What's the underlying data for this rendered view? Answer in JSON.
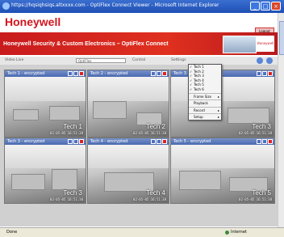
{
  "window": {
    "title": "https://hqsiqhsiqs.altxxxx.com - OptiFlex Connect Viewer - Microsoft Internet Explorer"
  },
  "header": {
    "logo": "Honeywell",
    "top_link": "Logout",
    "banner_title": "Honeywell Security & Custom Electronics – OptiFlex Connect",
    "brand": "Honeywell"
  },
  "toolbar": {
    "label_left": "Video Live",
    "select_value": "OptiFlex",
    "label_mid": "Control",
    "label_right": "Settings"
  },
  "tiles": [
    {
      "title": "Tech 1 - encrypted",
      "name": "Tech 1",
      "ts": "02-05-05 16:51:38"
    },
    {
      "title": "Tech 2 - encrypted",
      "name": "Tech 2",
      "ts": "02-05-05 16:51:38"
    },
    {
      "title": "Tech 3 - encrypted",
      "name": "Tech 3",
      "ts": "02-05-05 16:51:38"
    },
    {
      "title": "Tech 3 - encrypted",
      "name": "Tech 3",
      "ts": "02-05-05 16:51:38"
    },
    {
      "title": "Tech 4 - encrypted",
      "name": "Tech 4",
      "ts": "02-05-05 16:51:38"
    },
    {
      "title": "Tech 5 - encrypted",
      "name": "Tech 5",
      "ts": "02-05-05 16:51:38"
    }
  ],
  "context_menu": {
    "cameras": [
      "Tech 1",
      "Tech 2",
      "Tech 3",
      "Tech 4",
      "Tech 5",
      "Tech 6"
    ],
    "check": "✓",
    "items": [
      {
        "label": "Frame Size",
        "has_sub": true
      },
      {
        "label": "Playback",
        "has_sub": false
      },
      {
        "label": "Record",
        "has_sub": true
      },
      {
        "label": "Setup",
        "has_sub": true
      }
    ],
    "submenu_arrow": "▸"
  },
  "status": {
    "left": "Done",
    "right": "Internet"
  }
}
